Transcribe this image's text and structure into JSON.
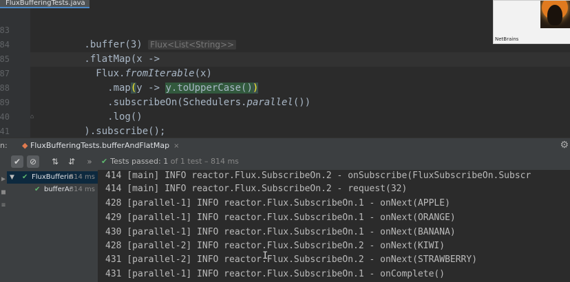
{
  "editor": {
    "file_tab": "FluxBufferingTests.java",
    "lines": [
      {
        "num": "83",
        "code_pre": "        .buffer(3) ",
        "hint": "Flux<List<String>>"
      },
      {
        "num": "84",
        "code": "        .flatMap(x ->"
      },
      {
        "num": "85",
        "code_pre": "          Flux.",
        "code_it": "fromIterable",
        "code_post": "(x)"
      },
      {
        "num": "87",
        "code_pre": "            .map",
        "paren_open": "(",
        "code_mid": "y -> ",
        "code_sel": "y.toUpperCase()",
        "paren_close": ")"
      },
      {
        "num": "88",
        "code_pre": "            .subscribeOn(Schedulers.",
        "code_it": "parallel",
        "code_post": "())"
      },
      {
        "num": "89",
        "code": "            .log()"
      },
      {
        "num": "40",
        "code": "        ).subscribe();"
      },
      {
        "num": "41",
        "code": "    }"
      },
      {
        "num": "42",
        "code": ""
      }
    ]
  },
  "webcam": {
    "label": "NetBrains"
  },
  "run_panel": {
    "prefix": "n:",
    "tab_label": "FluxBufferingTests.bufferAndFlatMap",
    "close": "×",
    "toolbar": {
      "more": "»",
      "status_prefix": "Tests passed:",
      "status_count": "1",
      "status_suffix": "of 1 test – 814 ms"
    },
    "tree": [
      {
        "name": "FluxBufferin",
        "time": "814 ms"
      },
      {
        "name": "bufferAr",
        "time": "814 ms"
      }
    ],
    "console": [
      "414 [main] INFO reactor.Flux.SubscribeOn.2 - onSubscribe(FluxSubscribeOn.Subscr",
      "414 [main] INFO reactor.Flux.SubscribeOn.2 - request(32)",
      "428 [parallel-1] INFO reactor.Flux.SubscribeOn.1 - onNext(APPLE)",
      "429 [parallel-1] INFO reactor.Flux.SubscribeOn.1 - onNext(ORANGE)",
      "430 [parallel-1] INFO reactor.Flux.SubscribeOn.1 - onNext(BANANA)",
      "428 [parallel-2] INFO reactor.Flux.SubscribeOn.2 - onNext(KIWI)",
      "431 [parallel-2] INFO reactor.Flux.SubscribeOn.2 - onNext(STRAWBERRY)",
      "431 [parallel-1] INFO reactor.Flux.SubscribeOn.1 - onComplete()"
    ]
  }
}
